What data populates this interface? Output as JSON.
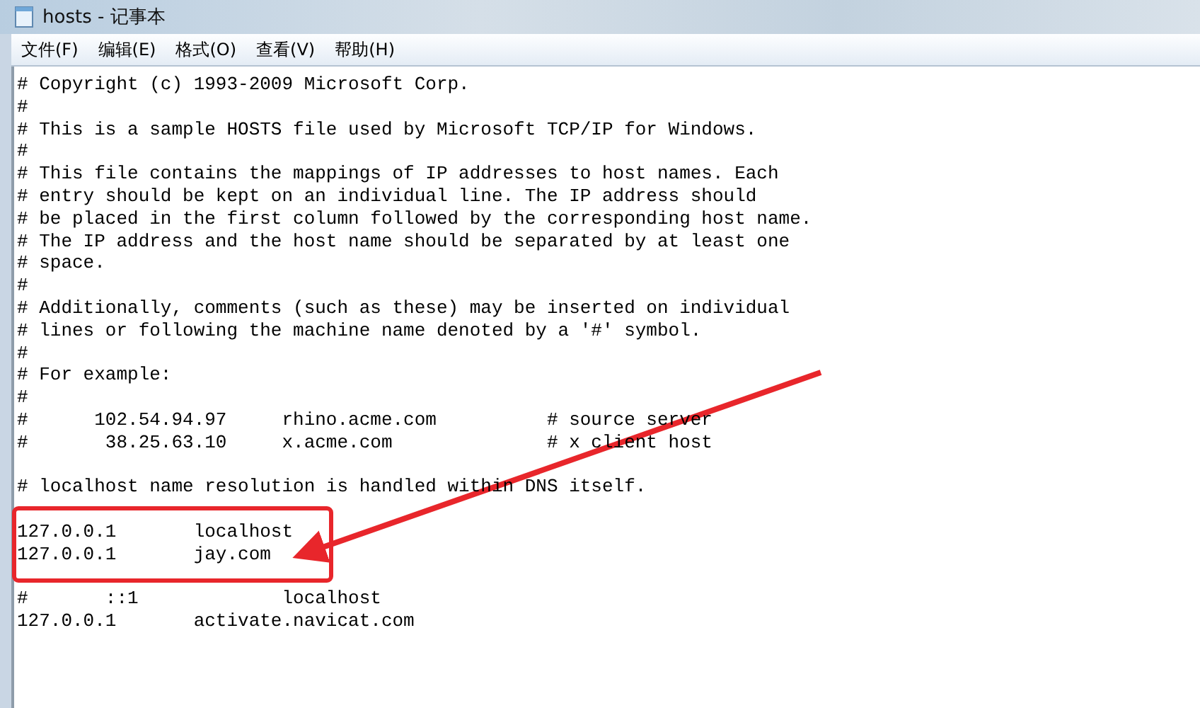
{
  "window": {
    "title": "hosts - 记事本"
  },
  "menu": [
    "文件(F)",
    "编辑(E)",
    "格式(O)",
    "查看(V)",
    "帮助(H)"
  ],
  "paragraphs": [
    [
      "# Copyright (c) 1993-2009 Microsoft Corp.",
      "#",
      "# This is a sample HOSTS file used by Microsoft TCP/IP for Windows.",
      "#",
      "# This file contains the mappings of IP addresses to host names. Each",
      "# entry should be kept on an individual line. The IP address should",
      "# be placed in the first column followed by the corresponding host name.",
      "# The IP address and the host name should be separated by at least one",
      "# space.",
      "#",
      "# Additionally, comments (such as these) may be inserted on individual",
      "# lines or following the machine name denoted by a '#' symbol.",
      "#",
      "# For example:",
      "#",
      "#      102.54.94.97     rhino.acme.com          # source server",
      "#       38.25.63.10     x.acme.com              # x client host"
    ],
    [
      "# localhost name resolution is handled within DNS itself."
    ],
    [
      "127.0.0.1       localhost",
      "127.0.0.1       jay.com"
    ],
    [
      "#       ::1             localhost",
      "127.0.0.1       activate.navicat.com"
    ]
  ]
}
